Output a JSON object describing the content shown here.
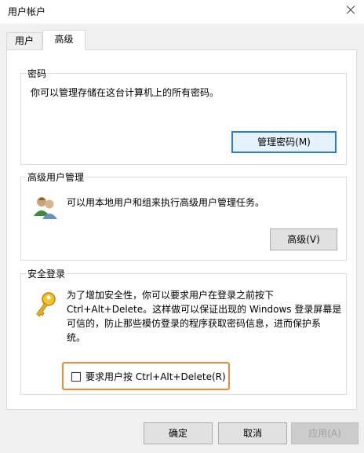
{
  "window": {
    "title": "用户帐户",
    "close_icon": "close-icon"
  },
  "tabs": [
    {
      "label": "用户",
      "selected": false
    },
    {
      "label": "高级",
      "selected": true
    }
  ],
  "passwords": {
    "title": "密码",
    "text": "你可以管理存储在这台计算机上的所有密码。",
    "button": "管理密码(M)"
  },
  "advanced_users": {
    "title": "高级用户管理",
    "text": "可以用本地用户和组来执行高级用户管理任务。",
    "button": "高级(V)",
    "icon": "users-icon"
  },
  "secure_logon": {
    "title": "安全登录",
    "text_lines": [
      "为了增加安全性，你可以要求用户在登录之前按下",
      "Ctrl+Alt+Delete。这样做可以保证出现的 Windows 登录屏幕是",
      "可信的，防止那些模仿登录的程序获取密码信息，进而保护系",
      "统。"
    ],
    "checkbox_label": "要求用户按 Ctrl+Alt+Delete(R)",
    "checkbox_checked": false,
    "icon": "key-icon",
    "highlight_color": "#f08a3c"
  },
  "footer": {
    "ok": "确定",
    "cancel": "取消",
    "apply": "应用(A)"
  }
}
